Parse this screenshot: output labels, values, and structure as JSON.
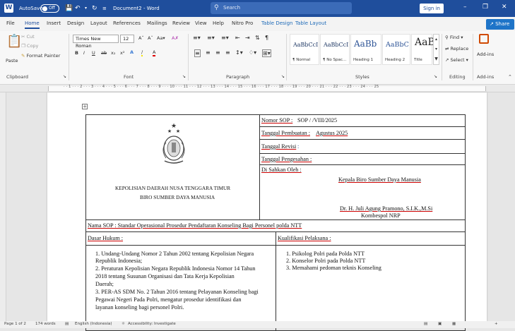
{
  "titlebar": {
    "autosave_label": "AutoSave",
    "autosave_state": "Off",
    "document_title": "Document2 - Word",
    "search_placeholder": "Search",
    "signin_label": "Sign in"
  },
  "tabs": [
    "File",
    "Home",
    "Insert",
    "Design",
    "Layout",
    "References",
    "Mailings",
    "Review",
    "View",
    "Help",
    "Nitro Pro",
    "Table Design",
    "Table Layout"
  ],
  "share_label": "Share",
  "clipboard": {
    "paste": "Paste",
    "cut": "Cut",
    "copy": "Copy",
    "format_painter": "Format Painter",
    "label": "Clipboard"
  },
  "font": {
    "name": "Times New Roman",
    "size": "12",
    "label": "Font"
  },
  "paragraph_label": "Paragraph",
  "styles": {
    "items": [
      {
        "sample": "AaBbCcI",
        "name": "¶ Normal"
      },
      {
        "sample": "AaBbCcI",
        "name": "¶ No Spac..."
      },
      {
        "sample": "AaBb",
        "name": "Heading 1"
      },
      {
        "sample": "AaBbC",
        "name": "Heading 2"
      },
      {
        "sample": "AaB",
        "name": "Title"
      }
    ],
    "label": "Styles"
  },
  "editing": {
    "find": "Find",
    "replace": "Replace",
    "select": "Select",
    "label": "Editing"
  },
  "addins": {
    "button": "Add-ins",
    "label": "Add-ins"
  },
  "ruler_numbers": "· · 1 · · · 2 · · · 3 · · · 4 · · · 5 · · · 6 · · · 7 · · · 8 · · · 9 · · · 10 · · · 11 · · · 12 · · · 13 · · · 14 · · · 15 · · · 16 · · · 17 · · · 18 · · · 19 · · · 20 · · · 21 · · · 22 · · · 23 · · · 24 · · · 25",
  "doc": {
    "org_line1": "KEPOLISIAN DAERAH NUSA TENGGARA TIMUR",
    "org_line2": "BIRO SUMBER DAYA MANUSIA",
    "sop_no_label": "Nomor SOP :",
    "sop_no_value": "SOP /        /VIII/2025",
    "created_label": "Tanggal Pembuatan :",
    "created_value": "Agustus 2025",
    "revision_label": "Tanggal Revisi",
    "revision_value": ":",
    "approval_label": "Tanggal Pengesahan :",
    "ratified_label": "Di Sahkan Oleh :",
    "head_title": "Kepala Biro Sumber Daya   Manusia",
    "head_name": "Dr. H. Juli Agung Pramono, S.I.K.,M.Si",
    "head_rank": "Kombespol NRP",
    "sop_name": "Nama SOP :  Standar Operasional Prosedur Pendaftaran Konseling Bagi Personel polda NTT",
    "legal_basis_label": "Dasar Hukum :",
    "qualification_label": "Kualifikasi Pelaksana :",
    "legal_basis_lines": [
      "1.  Undang-Undang Nomor 2 Tahun 2002 tentang Kepolisian Negara",
      "     Republik Indonesia;",
      "2.  Peraturan Kepolisian Negara Republik Indonesia Nomor 14 Tahun",
      "     2018 tentang Susunan Organisasi dan Tata Kerja Kepolisian",
      "     Daerah;",
      "3.  PER-AS SDM No. 2 Tahun 2016 tentang Pelayanan Konseling bagi",
      "     Pegawai Negeri Pada Polri, mengatur prosedur identifikasi dan",
      "     layanan konseling bagi personel Polri."
    ],
    "qualification_lines": [
      "1.   Psikolog Polri pada Polda NTT",
      "2.   Konselor Polri pada Polda NTT",
      "3.   Memahami pedoman teknis Konseling"
    ]
  },
  "status": {
    "page": "Page 1 of 2",
    "words": "174 words",
    "language": "English (Indonesia)",
    "accessibility": "Accessibility: Investigate"
  }
}
